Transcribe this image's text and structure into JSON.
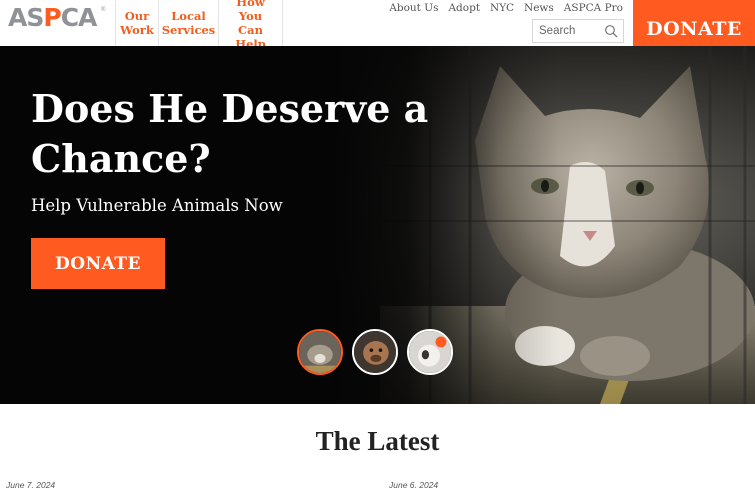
{
  "brand": {
    "logo_text_1": "AS",
    "logo_text_o": "P",
    "logo_text_2": "CA",
    "registered": "®"
  },
  "nav": {
    "items": [
      {
        "label": "Our\nWork"
      },
      {
        "label": "Local\nServices"
      },
      {
        "label": "How You\nCan Help"
      }
    ]
  },
  "utility": {
    "links": [
      "About Us",
      "Adopt",
      "NYC",
      "News",
      "ASPCA Pro"
    ]
  },
  "search": {
    "placeholder": "Search",
    "icon": "magnifier-icon"
  },
  "header_donate": {
    "label": "DONATE"
  },
  "hero": {
    "title": "Does He Deserve a Chance?",
    "subtitle": "Help Vulnerable Animals Now",
    "donate_label": "DONATE",
    "thumbnails": [
      {
        "name": "cat-thumbnail",
        "active": true
      },
      {
        "name": "dog-thumbnail",
        "active": false
      },
      {
        "name": "puppy-thumbnail",
        "active": false
      }
    ]
  },
  "latest": {
    "title": "The Latest",
    "dates": [
      "June 7, 2024",
      "June 6, 2024"
    ]
  },
  "colors": {
    "accent": "#ff5a1f",
    "nav_text": "#f25d1e",
    "hero_bg": "#050505"
  }
}
